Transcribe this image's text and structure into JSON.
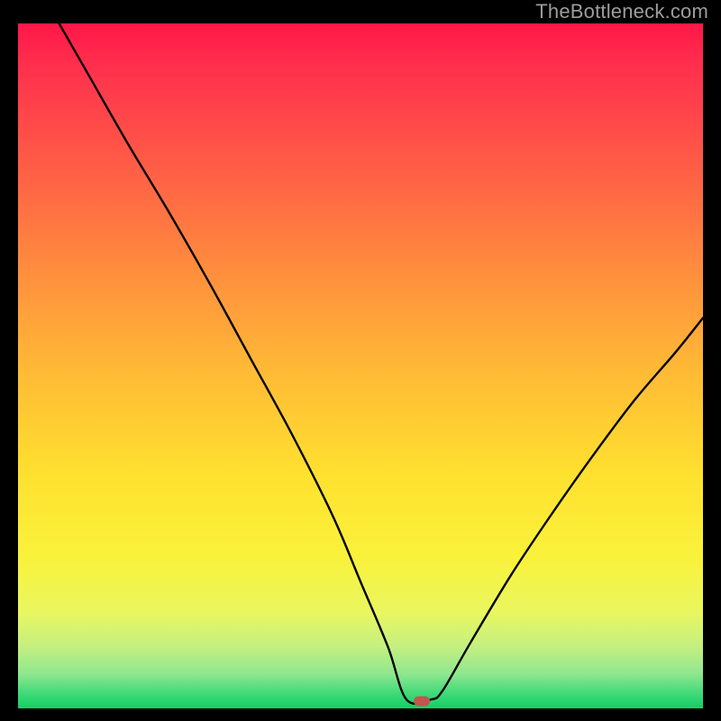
{
  "watermark": "TheBottleneck.com",
  "chart_data": {
    "type": "line",
    "title": "",
    "xlabel": "",
    "ylabel": "",
    "xlim": [
      0,
      100
    ],
    "ylim": [
      0,
      100
    ],
    "grid": false,
    "legend": false,
    "series": [
      {
        "name": "curve",
        "x": [
          6,
          10,
          16,
          22,
          28,
          34,
          40,
          46,
          50,
          54,
          56.7,
          60.3,
          62,
          66,
          72,
          78,
          84,
          90,
          96,
          100
        ],
        "y": [
          100,
          93,
          82.5,
          72.5,
          62,
          51,
          40,
          28,
          18.5,
          9,
          1.3,
          1.3,
          2.6,
          9.5,
          19.5,
          28.5,
          37,
          45,
          52,
          57
        ]
      }
    ],
    "marker": {
      "x": 59,
      "y": 1.1
    },
    "colors": {
      "curve": "#000000",
      "background_frame": "#000000",
      "marker": "#c1564e"
    }
  }
}
